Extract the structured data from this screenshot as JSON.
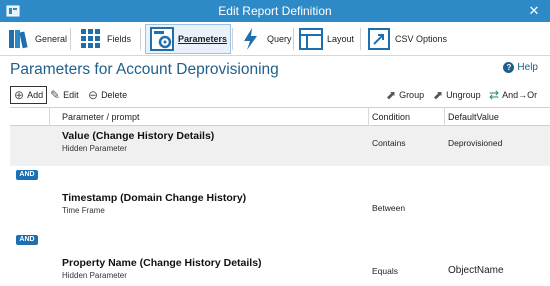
{
  "window": {
    "title": "Edit Report Definition",
    "close_glyph": "✕"
  },
  "ribbon": {
    "tabs": [
      {
        "label": "General",
        "icon": "books-icon"
      },
      {
        "label": "Fields",
        "icon": "grid-icon"
      },
      {
        "label": "Parameters",
        "icon": "parameters-gear-icon",
        "active": true
      },
      {
        "label": "Query",
        "icon": "lightning-icon"
      },
      {
        "label": "Layout",
        "icon": "layout-icon"
      },
      {
        "label": "CSV Options",
        "icon": "export-icon"
      }
    ]
  },
  "page": {
    "title": "Parameters for Account Deprovisioning",
    "help_label": "Help"
  },
  "toolbar": {
    "add_label": "Add",
    "edit_label": "Edit",
    "delete_label": "Delete",
    "group_label": "Group",
    "ungroup_label": "Ungroup",
    "and_or_label": "And→Or"
  },
  "table": {
    "columns": {
      "param": "Parameter / prompt",
      "condition": "Condition",
      "default": "DefaultValue"
    },
    "rows": [
      {
        "title": "Value (Change History Details)",
        "subtitle": "Hidden Parameter",
        "condition": "Contains",
        "default": "Deprovisioned"
      },
      {
        "title": "Timestamp (Domain Change History)",
        "subtitle": "Time Frame",
        "condition": "Between",
        "default": ""
      },
      {
        "title": "Property Name (Change History Details)",
        "subtitle": "Hidden Parameter",
        "condition": "Equals",
        "default": "ObjectName"
      }
    ],
    "and_label": "AND"
  },
  "colors": {
    "titlebar": "#2d8ac7",
    "heading": "#1f5f8b",
    "and_badge": "#1b6fb2"
  }
}
